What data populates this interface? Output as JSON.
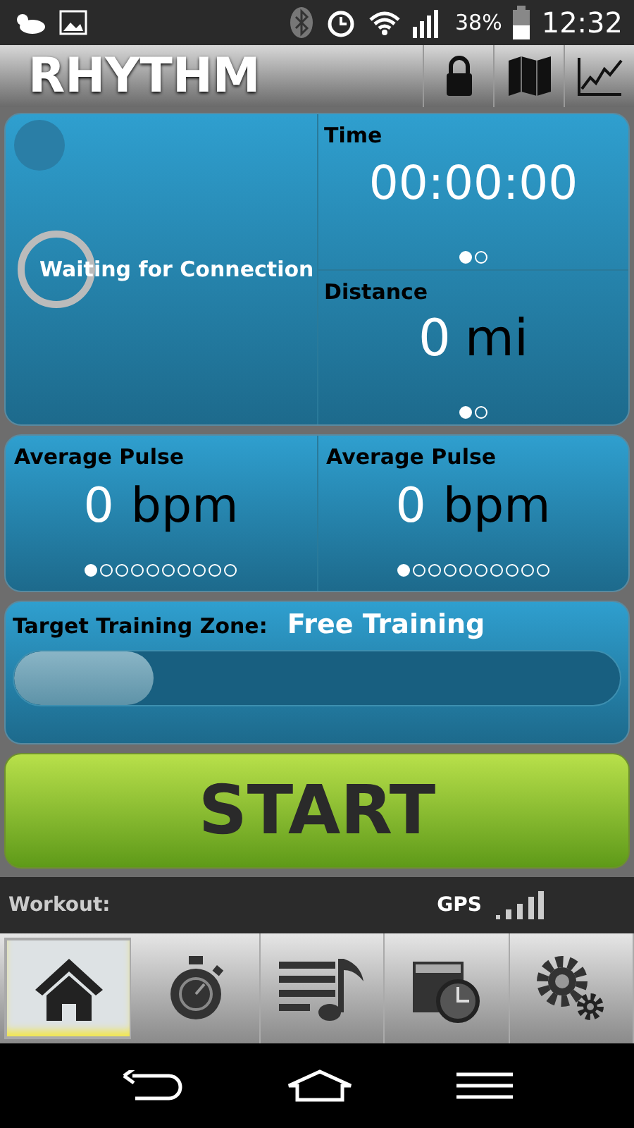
{
  "status_bar": {
    "battery": "38%",
    "time": "12:32"
  },
  "header": {
    "title": "RHYTHM"
  },
  "connection": {
    "label": "Waiting for Connection"
  },
  "time": {
    "label": "Time",
    "value": "00:00:00",
    "dots": [
      {
        "selected": true
      },
      {
        "selected": false
      }
    ]
  },
  "distance": {
    "label": "Distance",
    "value": "0",
    "unit": "mi",
    "dots": [
      {
        "selected": true
      },
      {
        "selected": false
      }
    ]
  },
  "pulse": [
    {
      "label": "Average Pulse",
      "value": "0",
      "unit": "bpm",
      "dots": [
        {
          "selected": true
        },
        {
          "selected": false
        },
        {
          "selected": false
        },
        {
          "selected": false
        },
        {
          "selected": false
        },
        {
          "selected": false
        },
        {
          "selected": false
        },
        {
          "selected": false
        },
        {
          "selected": false
        },
        {
          "selected": false
        }
      ]
    },
    {
      "label": "Average Pulse",
      "value": "0",
      "unit": "bpm",
      "dots": [
        {
          "selected": true
        },
        {
          "selected": false
        },
        {
          "selected": false
        },
        {
          "selected": false
        },
        {
          "selected": false
        },
        {
          "selected": false
        },
        {
          "selected": false
        },
        {
          "selected": false
        },
        {
          "selected": false
        },
        {
          "selected": false
        }
      ]
    }
  ],
  "zone": {
    "label": "Target Training Zone:",
    "value": "Free Training",
    "level": 0.23
  },
  "start_button": "START",
  "info_bar": {
    "workout": "Workout:",
    "gps": "GPS"
  },
  "tabs": [
    {
      "kind": "home",
      "selected": true
    },
    {
      "kind": "stopwatch",
      "selected": false
    },
    {
      "kind": "playlist",
      "selected": false
    },
    {
      "kind": "schedule",
      "selected": false
    },
    {
      "kind": "settings",
      "selected": false
    }
  ]
}
